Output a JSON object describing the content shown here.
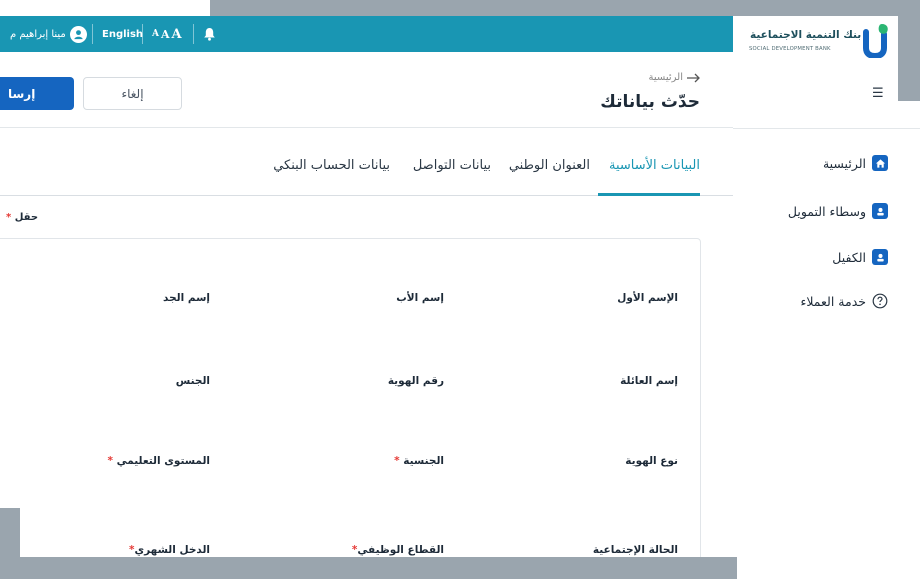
{
  "topbar": {
    "user_name": "مينا إبراهيم م",
    "language_label": "English",
    "font_size_glyphs": [
      "A",
      "A",
      "A"
    ]
  },
  "header": {
    "breadcrumb": "الرئيسية",
    "title": "حدّث بياناتك",
    "cancel_label": "إلغاء",
    "send_label": "إرسا"
  },
  "tabs": [
    {
      "label": "البيانات الأساسية",
      "active": true
    },
    {
      "label": "العنوان الوطني",
      "active": false
    },
    {
      "label": "بيانات التواصل",
      "active": false
    },
    {
      "label": "بيانات الحساب البنكي",
      "active": false
    }
  ],
  "form": {
    "required_note": "حقل",
    "required_star": "*",
    "fields": [
      {
        "label": "الإسم الأول",
        "required": false
      },
      {
        "label": "إسم الأب",
        "required": false
      },
      {
        "label": "إسم الجد",
        "required": false
      },
      {
        "label": "إسم العائلة",
        "required": false
      },
      {
        "label": "رقم الهوية",
        "required": false
      },
      {
        "label": "الجنس",
        "required": false
      },
      {
        "label": "نوع الهوية",
        "required": false
      },
      {
        "label": "الجنسية",
        "required": true
      },
      {
        "label": "المستوى التعليمي",
        "required": true
      },
      {
        "label": "الحالة الإجتماعية",
        "required": false
      },
      {
        "label": "القطاع الوظيفي",
        "required": true
      },
      {
        "label": "الدخل الشهري",
        "required": true
      }
    ]
  },
  "sidebar": {
    "logo_ar": "بنك التنمية الاجتماعية",
    "logo_en": "SOCIAL DEVELOPMENT BANK",
    "items": [
      {
        "label": "الرئيسية",
        "icon": "home-icon"
      },
      {
        "label": "وسطاء التمويل",
        "icon": "user-badge-icon"
      },
      {
        "label": "الكفيل",
        "icon": "user-badge-icon"
      },
      {
        "label": "خدمة العملاء",
        "icon": "help-circle-icon"
      }
    ]
  },
  "colors": {
    "topbar": "#1996b3",
    "primary": "#1565c0",
    "active_tab": "#1996b3",
    "required": "#e53935"
  }
}
